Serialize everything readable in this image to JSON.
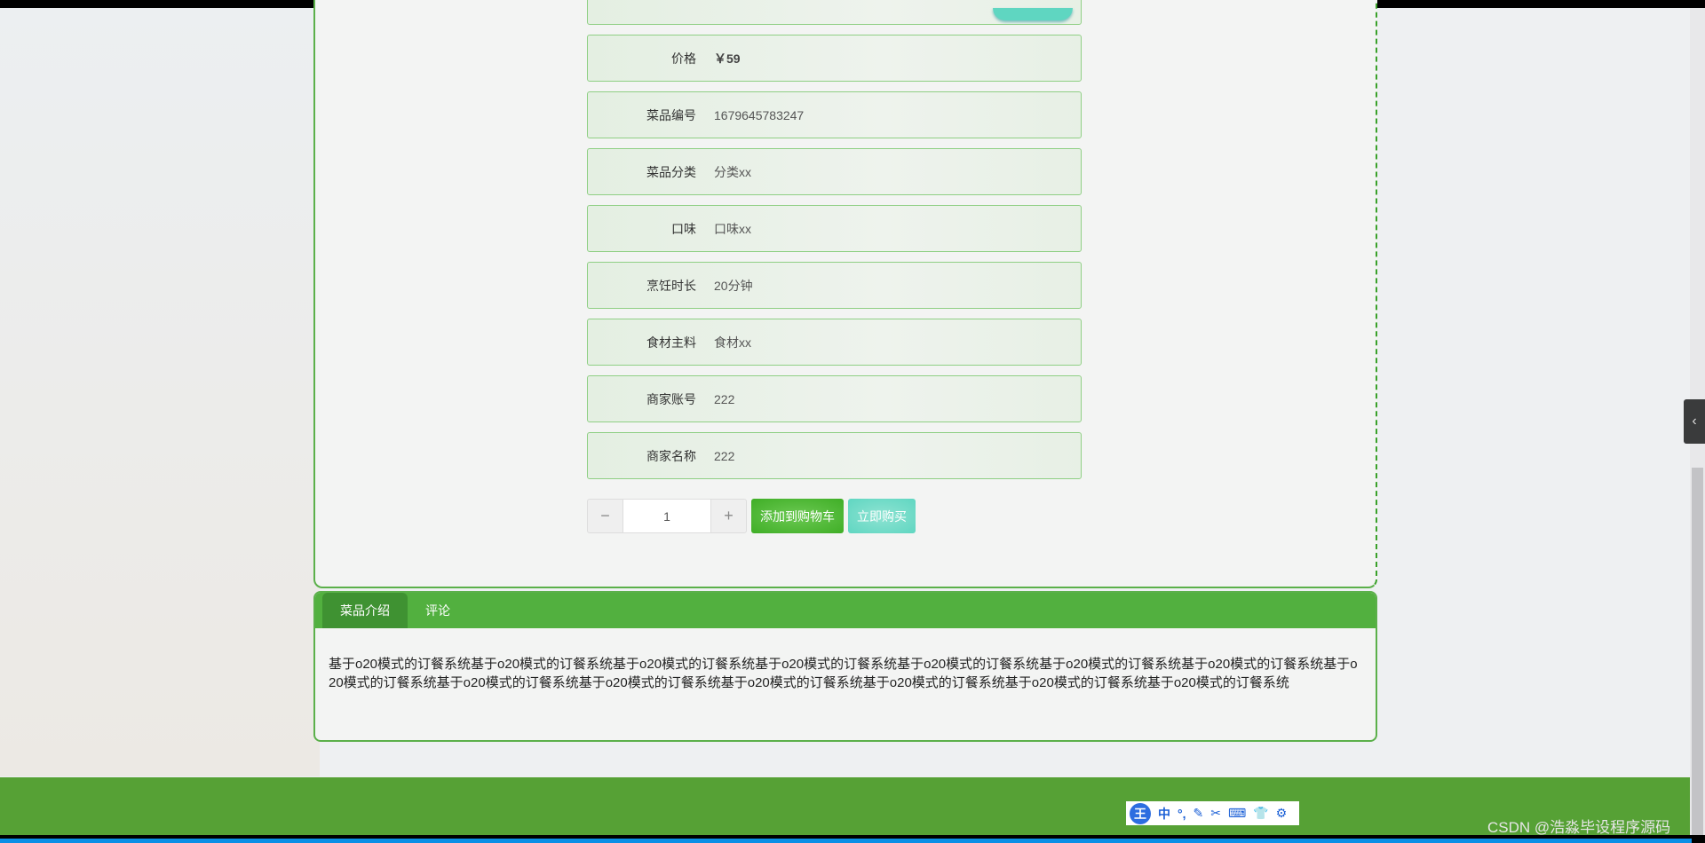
{
  "fields": [
    {
      "label": "价格",
      "value": "￥59"
    },
    {
      "label": "菜品编号",
      "value": "1679645783247"
    },
    {
      "label": "菜品分类",
      "value": "分类xx"
    },
    {
      "label": "口味",
      "value": "口味xx"
    },
    {
      "label": "烹饪时长",
      "value": "20分钟"
    },
    {
      "label": "食材主料",
      "value": "食材xx"
    },
    {
      "label": "商家账号",
      "value": "222"
    },
    {
      "label": "商家名称",
      "value": "222"
    }
  ],
  "quantity": {
    "minus": "−",
    "value": "1",
    "plus": "+"
  },
  "buttons": {
    "add_cart": "添加到购物车",
    "buy_now": "立即购买"
  },
  "tabs": [
    {
      "label": "菜品介绍",
      "active": true
    },
    {
      "label": "评论",
      "active": false
    }
  ],
  "description": "基于o20模式的订餐系统基于o20模式的订餐系统基于o20模式的订餐系统基于o20模式的订餐系统基于o20模式的订餐系统基于o20模式的订餐系统基于o20模式的订餐系统基于o20模式的订餐系统基于o20模式的订餐系统基于o20模式的订餐系统基于o20模式的订餐系统基于o20模式的订餐系统基于o20模式的订餐系统基于o20模式的订餐系统",
  "ime": {
    "logo": "王",
    "mode": "中",
    "punct": "°,"
  },
  "watermark": "CSDN @浩淼毕设程序源码",
  "colors": {
    "green": "#52b03f",
    "teal": "#5fd6c1"
  }
}
